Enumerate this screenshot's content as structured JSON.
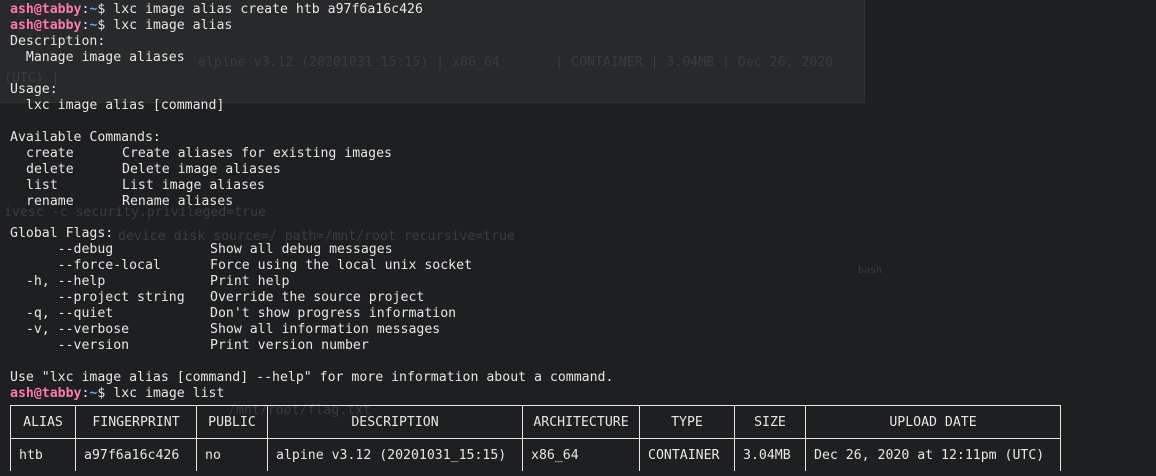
{
  "prompt": {
    "user": "ash@tabby",
    "path": "~",
    "symbol": "$"
  },
  "commands": {
    "create": "lxc image alias create htb a97f6a16c426",
    "alias": "lxc image alias",
    "list": "lxc image list"
  },
  "help": {
    "description_label": "Description:",
    "description": "Manage image aliases",
    "usage_label": "Usage:",
    "usage": "lxc image alias [command]",
    "available_label": "Available Commands:",
    "available": [
      {
        "name": "create",
        "desc": "Create aliases for existing images"
      },
      {
        "name": "delete",
        "desc": "Delete image aliases"
      },
      {
        "name": "list",
        "desc": "List image aliases"
      },
      {
        "name": "rename",
        "desc": "Rename aliases"
      }
    ],
    "global_label": "Global Flags:",
    "flags": [
      {
        "flag": "      --debug",
        "desc": "Show all debug messages"
      },
      {
        "flag": "      --force-local",
        "desc": "Force using the local unix socket"
      },
      {
        "flag": "  -h, --help",
        "desc": "Print help"
      },
      {
        "flag": "      --project string",
        "desc": "Override the source project"
      },
      {
        "flag": "  -q, --quiet",
        "desc": "Don't show progress information"
      },
      {
        "flag": "  -v, --verbose",
        "desc": "Show all information messages"
      },
      {
        "flag": "      --version",
        "desc": "Print version number"
      }
    ],
    "footer": "Use \"lxc image alias [command] --help\" for more information about a command."
  },
  "image_table": {
    "headers": [
      "ALIAS",
      "FINGERPRINT",
      "PUBLIC",
      "DESCRIPTION",
      "ARCHITECTURE",
      "TYPE",
      "SIZE",
      "UPLOAD DATE"
    ],
    "rows": [
      [
        "htb",
        "a97f6a16c426",
        "no",
        "alpine v3.12 (20201031_15:15)",
        "x86_64",
        "CONTAINER",
        "3.04MB",
        "Dec 26, 2020 at 12:11pm (UTC)"
      ]
    ]
  },
  "background": {
    "ghost_row": "alpine v3.12 (20201031_15:15) | x86_64       | CONTAINER | 3.04MB | Dec 26, 2020",
    "ghost_utc": "(UTC) |",
    "ghost_cmd1": "ivesc -c security.privileged=true",
    "ghost_cmd2": "device disk source=/ path=/mnt/root recursive=true",
    "ghost_label": "bash",
    "ghost_cmd3": "/mnt/root/flag.txt"
  },
  "colors": {
    "background": "#1d1f21",
    "prompt_user": "#ff79a8",
    "prompt_path": "#5aa8ff",
    "text": "#e6e6e6"
  }
}
